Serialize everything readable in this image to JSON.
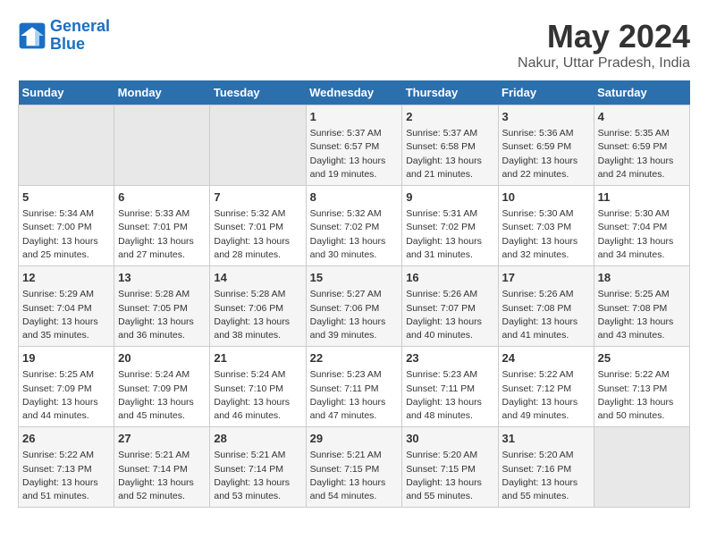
{
  "header": {
    "logo_line1": "General",
    "logo_line2": "Blue",
    "main_title": "May 2024",
    "sub_title": "Nakur, Uttar Pradesh, India"
  },
  "days_of_week": [
    "Sunday",
    "Monday",
    "Tuesday",
    "Wednesday",
    "Thursday",
    "Friday",
    "Saturday"
  ],
  "weeks": [
    [
      {
        "day": "",
        "content": ""
      },
      {
        "day": "",
        "content": ""
      },
      {
        "day": "",
        "content": ""
      },
      {
        "day": "1",
        "content": "Sunrise: 5:37 AM\nSunset: 6:57 PM\nDaylight: 13 hours\nand 19 minutes."
      },
      {
        "day": "2",
        "content": "Sunrise: 5:37 AM\nSunset: 6:58 PM\nDaylight: 13 hours\nand 21 minutes."
      },
      {
        "day": "3",
        "content": "Sunrise: 5:36 AM\nSunset: 6:59 PM\nDaylight: 13 hours\nand 22 minutes."
      },
      {
        "day": "4",
        "content": "Sunrise: 5:35 AM\nSunset: 6:59 PM\nDaylight: 13 hours\nand 24 minutes."
      }
    ],
    [
      {
        "day": "5",
        "content": "Sunrise: 5:34 AM\nSunset: 7:00 PM\nDaylight: 13 hours\nand 25 minutes."
      },
      {
        "day": "6",
        "content": "Sunrise: 5:33 AM\nSunset: 7:01 PM\nDaylight: 13 hours\nand 27 minutes."
      },
      {
        "day": "7",
        "content": "Sunrise: 5:32 AM\nSunset: 7:01 PM\nDaylight: 13 hours\nand 28 minutes."
      },
      {
        "day": "8",
        "content": "Sunrise: 5:32 AM\nSunset: 7:02 PM\nDaylight: 13 hours\nand 30 minutes."
      },
      {
        "day": "9",
        "content": "Sunrise: 5:31 AM\nSunset: 7:02 PM\nDaylight: 13 hours\nand 31 minutes."
      },
      {
        "day": "10",
        "content": "Sunrise: 5:30 AM\nSunset: 7:03 PM\nDaylight: 13 hours\nand 32 minutes."
      },
      {
        "day": "11",
        "content": "Sunrise: 5:30 AM\nSunset: 7:04 PM\nDaylight: 13 hours\nand 34 minutes."
      }
    ],
    [
      {
        "day": "12",
        "content": "Sunrise: 5:29 AM\nSunset: 7:04 PM\nDaylight: 13 hours\nand 35 minutes."
      },
      {
        "day": "13",
        "content": "Sunrise: 5:28 AM\nSunset: 7:05 PM\nDaylight: 13 hours\nand 36 minutes."
      },
      {
        "day": "14",
        "content": "Sunrise: 5:28 AM\nSunset: 7:06 PM\nDaylight: 13 hours\nand 38 minutes."
      },
      {
        "day": "15",
        "content": "Sunrise: 5:27 AM\nSunset: 7:06 PM\nDaylight: 13 hours\nand 39 minutes."
      },
      {
        "day": "16",
        "content": "Sunrise: 5:26 AM\nSunset: 7:07 PM\nDaylight: 13 hours\nand 40 minutes."
      },
      {
        "day": "17",
        "content": "Sunrise: 5:26 AM\nSunset: 7:08 PM\nDaylight: 13 hours\nand 41 minutes."
      },
      {
        "day": "18",
        "content": "Sunrise: 5:25 AM\nSunset: 7:08 PM\nDaylight: 13 hours\nand 43 minutes."
      }
    ],
    [
      {
        "day": "19",
        "content": "Sunrise: 5:25 AM\nSunset: 7:09 PM\nDaylight: 13 hours\nand 44 minutes."
      },
      {
        "day": "20",
        "content": "Sunrise: 5:24 AM\nSunset: 7:09 PM\nDaylight: 13 hours\nand 45 minutes."
      },
      {
        "day": "21",
        "content": "Sunrise: 5:24 AM\nSunset: 7:10 PM\nDaylight: 13 hours\nand 46 minutes."
      },
      {
        "day": "22",
        "content": "Sunrise: 5:23 AM\nSunset: 7:11 PM\nDaylight: 13 hours\nand 47 minutes."
      },
      {
        "day": "23",
        "content": "Sunrise: 5:23 AM\nSunset: 7:11 PM\nDaylight: 13 hours\nand 48 minutes."
      },
      {
        "day": "24",
        "content": "Sunrise: 5:22 AM\nSunset: 7:12 PM\nDaylight: 13 hours\nand 49 minutes."
      },
      {
        "day": "25",
        "content": "Sunrise: 5:22 AM\nSunset: 7:13 PM\nDaylight: 13 hours\nand 50 minutes."
      }
    ],
    [
      {
        "day": "26",
        "content": "Sunrise: 5:22 AM\nSunset: 7:13 PM\nDaylight: 13 hours\nand 51 minutes."
      },
      {
        "day": "27",
        "content": "Sunrise: 5:21 AM\nSunset: 7:14 PM\nDaylight: 13 hours\nand 52 minutes."
      },
      {
        "day": "28",
        "content": "Sunrise: 5:21 AM\nSunset: 7:14 PM\nDaylight: 13 hours\nand 53 minutes."
      },
      {
        "day": "29",
        "content": "Sunrise: 5:21 AM\nSunset: 7:15 PM\nDaylight: 13 hours\nand 54 minutes."
      },
      {
        "day": "30",
        "content": "Sunrise: 5:20 AM\nSunset: 7:15 PM\nDaylight: 13 hours\nand 55 minutes."
      },
      {
        "day": "31",
        "content": "Sunrise: 5:20 AM\nSunset: 7:16 PM\nDaylight: 13 hours\nand 55 minutes."
      },
      {
        "day": "",
        "content": ""
      }
    ]
  ]
}
